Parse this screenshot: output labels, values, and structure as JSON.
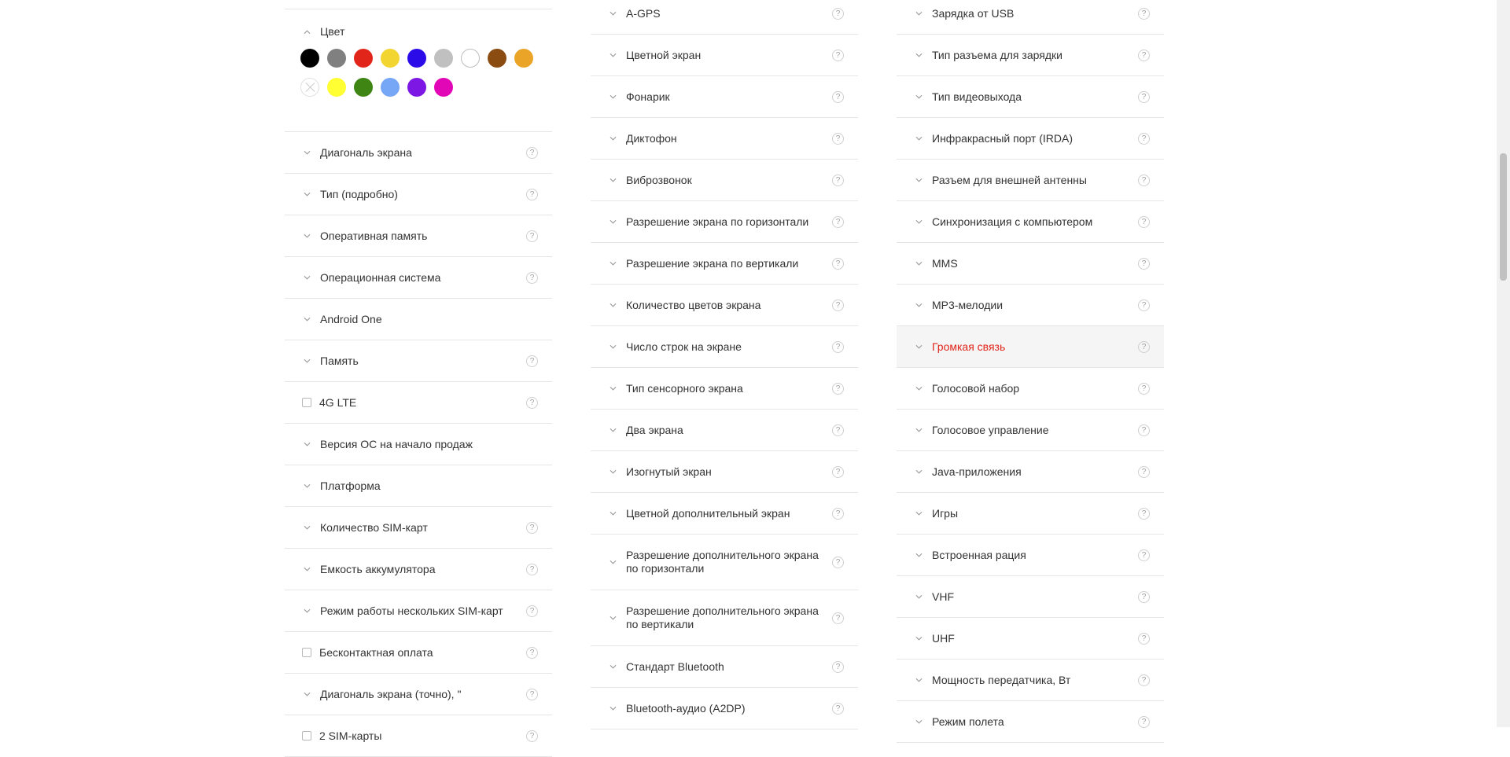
{
  "color_filter": {
    "title": "Цвет",
    "swatches_row1": [
      "#000000",
      "#808080",
      "#e1251b",
      "#f3d531",
      "#2b0be7",
      "#c0c0c0",
      "#ffffff",
      "#8b4c12",
      "#eaa529"
    ],
    "swatches_row2": [
      "transparent",
      "#ffff33",
      "#3e8514",
      "#76a6f6",
      "#7d17e3",
      "#e207b6"
    ]
  },
  "col1": {
    "items": [
      {
        "label": "Диагональ экрана",
        "kind": "collapse",
        "help": "?"
      },
      {
        "label": "Тип (подробно)",
        "kind": "collapse",
        "help": "?"
      },
      {
        "label": "Оперативная память",
        "kind": "collapse",
        "help": "?"
      },
      {
        "label": "Операционная система",
        "kind": "collapse",
        "help": "?"
      },
      {
        "label": "Android One",
        "kind": "collapse",
        "help": ""
      },
      {
        "label": "Память",
        "kind": "collapse",
        "help": "?"
      },
      {
        "label": "4G LTE",
        "kind": "checkbox",
        "help": "?"
      },
      {
        "label": "Версия ОС на начало продаж",
        "kind": "collapse",
        "help": ""
      },
      {
        "label": "Платформа",
        "kind": "collapse",
        "help": ""
      },
      {
        "label": "Количество SIM-карт",
        "kind": "collapse",
        "help": "?"
      },
      {
        "label": "Емкость аккумулятора",
        "kind": "collapse",
        "help": "?"
      },
      {
        "label": "Режим работы нескольких SIM-карт",
        "kind": "collapse",
        "help": "?"
      },
      {
        "label": "Бесконтактная оплата",
        "kind": "checkbox",
        "help": "?"
      },
      {
        "label": "Диагональ экрана (точно), \"",
        "kind": "collapse",
        "help": "?"
      },
      {
        "label": "2 SIM-карты",
        "kind": "checkbox",
        "help": "?"
      }
    ]
  },
  "col2": {
    "items": [
      {
        "label": "A-GPS",
        "kind": "collapse",
        "help": "?"
      },
      {
        "label": "Цветной экран",
        "kind": "collapse",
        "help": "?"
      },
      {
        "label": "Фонарик",
        "kind": "collapse",
        "help": "?"
      },
      {
        "label": "Диктофон",
        "kind": "collapse",
        "help": "?"
      },
      {
        "label": "Виброзвонок",
        "kind": "collapse",
        "help": "?"
      },
      {
        "label": "Разрешение экрана по горизонтали",
        "kind": "collapse",
        "help": "?"
      },
      {
        "label": "Разрешение экрана по вертикали",
        "kind": "collapse",
        "help": "?"
      },
      {
        "label": "Количество цветов экрана",
        "kind": "collapse",
        "help": "?"
      },
      {
        "label": "Число строк на экране",
        "kind": "collapse",
        "help": "?"
      },
      {
        "label": "Тип сенсорного экрана",
        "kind": "collapse",
        "help": "?"
      },
      {
        "label": "Два экрана",
        "kind": "collapse",
        "help": "?"
      },
      {
        "label": "Изогнутый экран",
        "kind": "collapse",
        "help": "?"
      },
      {
        "label": "Цветной дополнительный экран",
        "kind": "collapse",
        "help": "?"
      },
      {
        "label": "Разрешение дополнительного экрана по горизонтали",
        "kind": "collapse",
        "help": "?",
        "tall": true
      },
      {
        "label": "Разрешение дополнительного экрана по вертикали",
        "kind": "collapse",
        "help": "?",
        "tall": true
      },
      {
        "label": "Стандарт Bluetooth",
        "kind": "collapse",
        "help": "?"
      },
      {
        "label": "Bluetooth-аудио (A2DP)",
        "kind": "collapse",
        "help": "?"
      }
    ]
  },
  "col3": {
    "items": [
      {
        "label": "Зарядка от USB",
        "kind": "collapse",
        "help": "?"
      },
      {
        "label": "Тип разъема для зарядки",
        "kind": "collapse",
        "help": "?"
      },
      {
        "label": "Тип видеовыхода",
        "kind": "collapse",
        "help": "?"
      },
      {
        "label": "Инфракрасный порт (IRDA)",
        "kind": "collapse",
        "help": "?"
      },
      {
        "label": "Разъем для внешней антенны",
        "kind": "collapse",
        "help": "?"
      },
      {
        "label": "Синхронизация с компьютером",
        "kind": "collapse",
        "help": "?"
      },
      {
        "label": "MMS",
        "kind": "collapse",
        "help": "?"
      },
      {
        "label": "MP3-мелодии",
        "kind": "collapse",
        "help": "?"
      },
      {
        "label": "Громкая связь",
        "kind": "collapse",
        "help": "?",
        "highlight": true
      },
      {
        "label": "Голосовой набор",
        "kind": "collapse",
        "help": "?"
      },
      {
        "label": "Голосовое управление",
        "kind": "collapse",
        "help": "?"
      },
      {
        "label": "Java-приложения",
        "kind": "collapse",
        "help": "?"
      },
      {
        "label": "Игры",
        "kind": "collapse",
        "help": "?"
      },
      {
        "label": "Встроенная рация",
        "kind": "collapse",
        "help": "?"
      },
      {
        "label": "VHF",
        "kind": "collapse",
        "help": "?"
      },
      {
        "label": "UHF",
        "kind": "collapse",
        "help": "?"
      },
      {
        "label": "Мощность передатчика, Вт",
        "kind": "collapse",
        "help": "?"
      },
      {
        "label": "Режим полета",
        "kind": "collapse",
        "help": "?"
      }
    ]
  }
}
